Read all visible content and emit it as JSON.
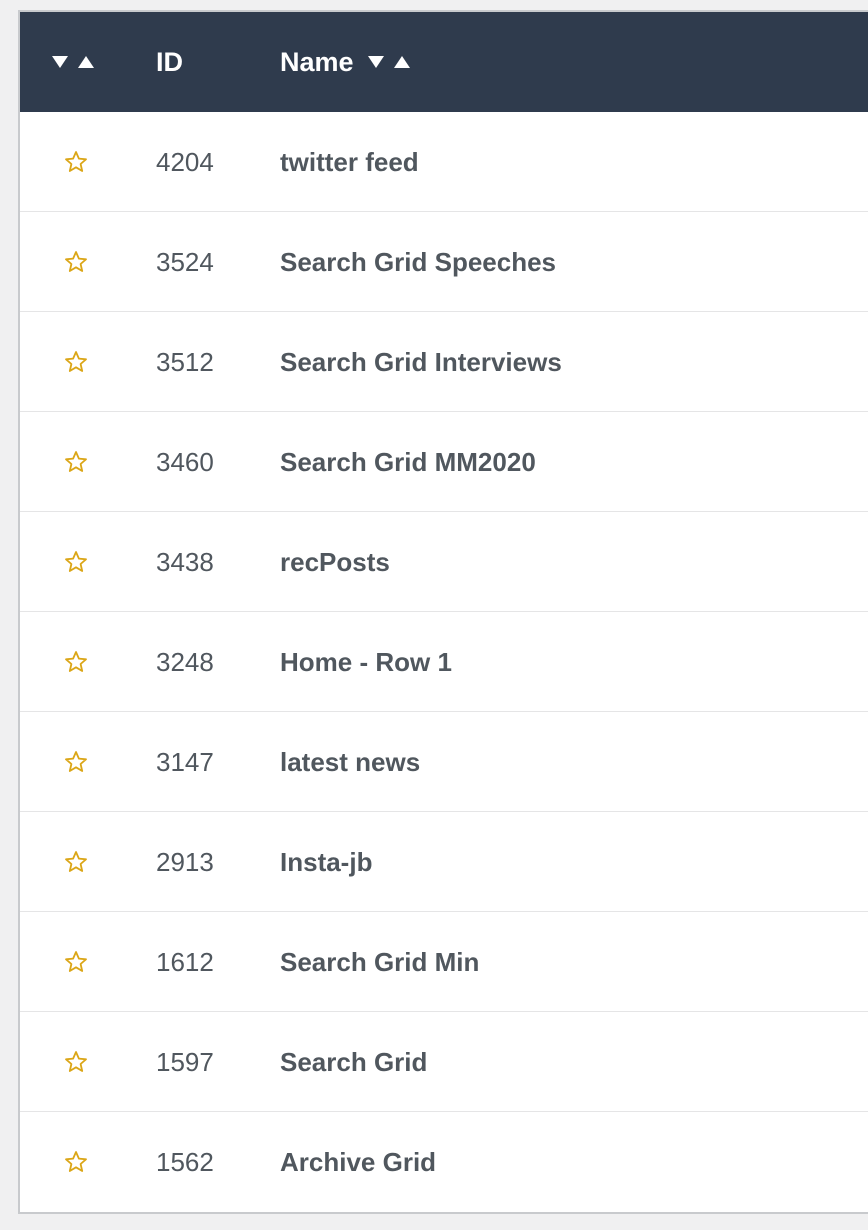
{
  "colors": {
    "header_bg": "#2f3b4d",
    "header_text": "#ffffff",
    "row_text": "#50575e",
    "star": "#dba617",
    "border": "#e5e5e6"
  },
  "header": {
    "sort_icons": [
      "sort-descending-icon",
      "sort-ascending-icon"
    ],
    "id_label": "ID",
    "name_label": "Name"
  },
  "rows": [
    {
      "icon": "star-outline-icon",
      "id": "4204",
      "name": "twitter feed"
    },
    {
      "icon": "star-outline-icon",
      "id": "3524",
      "name": "Search Grid Speeches"
    },
    {
      "icon": "star-outline-icon",
      "id": "3512",
      "name": "Search Grid Interviews"
    },
    {
      "icon": "star-outline-icon",
      "id": "3460",
      "name": "Search Grid MM2020"
    },
    {
      "icon": "star-outline-icon",
      "id": "3438",
      "name": "recPosts"
    },
    {
      "icon": "star-outline-icon",
      "id": "3248",
      "name": "Home - Row 1"
    },
    {
      "icon": "star-outline-icon",
      "id": "3147",
      "name": "latest news"
    },
    {
      "icon": "star-outline-icon",
      "id": "2913",
      "name": "Insta-jb"
    },
    {
      "icon": "star-outline-icon",
      "id": "1612",
      "name": "Search Grid Min"
    },
    {
      "icon": "star-outline-icon",
      "id": "1597",
      "name": "Search Grid"
    },
    {
      "icon": "star-outline-icon",
      "id": "1562",
      "name": "Archive Grid"
    }
  ]
}
